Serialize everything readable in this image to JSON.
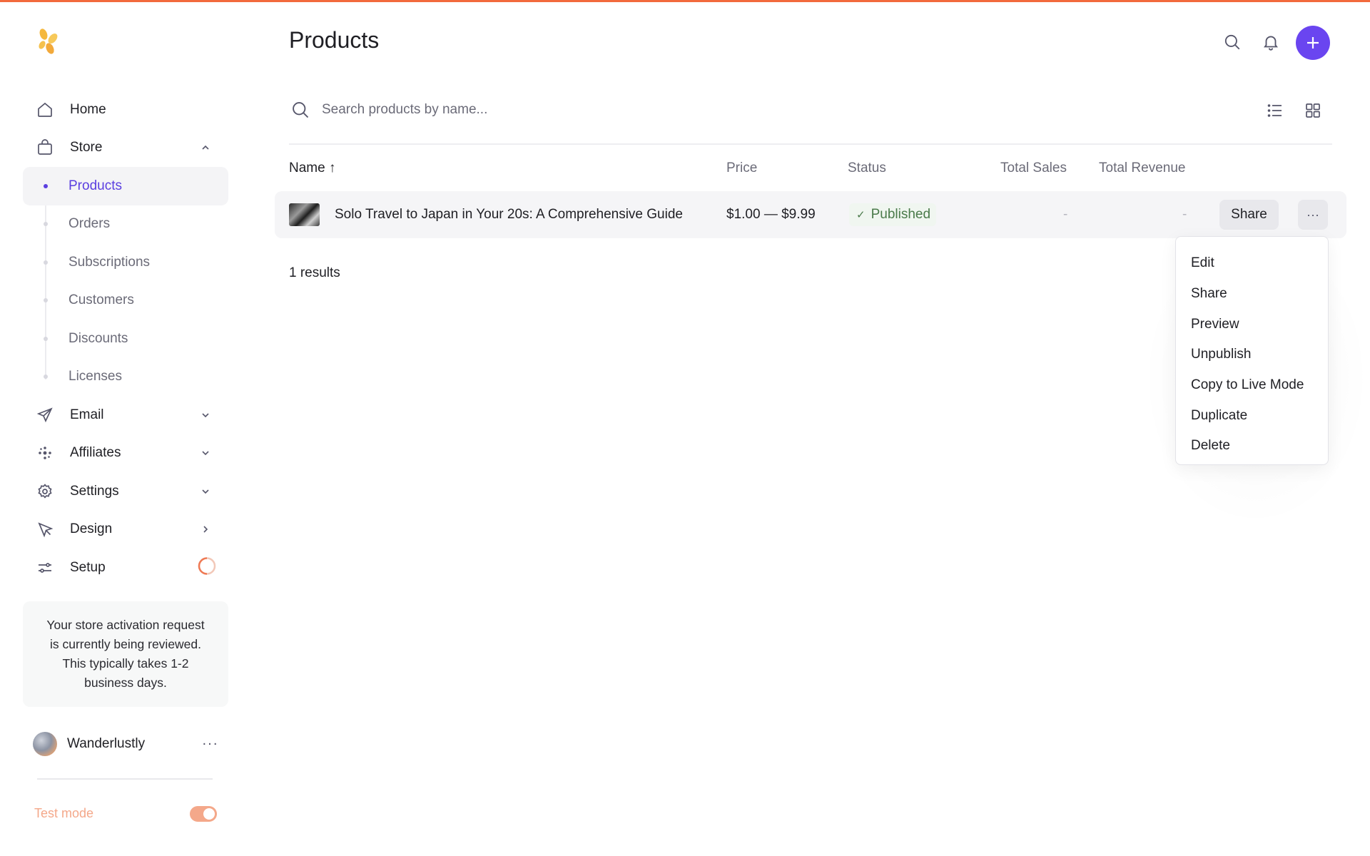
{
  "app": {
    "accent_color": "#6a45f0",
    "top_bar_color": "#f26a3d"
  },
  "sidebar": {
    "logo_icon": "petal-logo-icon",
    "items": [
      {
        "label": "Home",
        "icon": "home-icon"
      },
      {
        "label": "Store",
        "icon": "shopping-bag-icon",
        "expanded": true
      },
      {
        "label": "Email",
        "icon": "paper-plane-icon"
      },
      {
        "label": "Affiliates",
        "icon": "affiliates-icon"
      },
      {
        "label": "Settings",
        "icon": "gear-icon"
      },
      {
        "label": "Design",
        "icon": "cursor-icon"
      },
      {
        "label": "Setup",
        "icon": "sliders-icon"
      }
    ],
    "store_subitems": [
      {
        "label": "Products",
        "active": true
      },
      {
        "label": "Orders"
      },
      {
        "label": "Subscriptions"
      },
      {
        "label": "Customers"
      },
      {
        "label": "Discounts"
      },
      {
        "label": "Licenses"
      }
    ],
    "activation_message": "Your store activation request is currently being reviewed. This typically takes 1-2 business days.",
    "user": {
      "name": "Wanderlustly",
      "more": "···"
    },
    "test_mode": {
      "label": "Test mode",
      "enabled": true
    }
  },
  "header": {
    "title": "Products",
    "icons": [
      "search-icon",
      "bell-icon",
      "plus-icon"
    ]
  },
  "search": {
    "placeholder": "Search products by name..."
  },
  "table": {
    "columns": {
      "name": "Name ↑",
      "price": "Price",
      "status": "Status",
      "total_sales": "Total Sales",
      "total_revenue": "Total Revenue"
    },
    "rows": [
      {
        "name": "Solo Travel to Japan in Your 20s: A Comprehensive Guide",
        "price": "$1.00 — $9.99",
        "status": "Published",
        "total_sales": "-",
        "total_revenue": "-",
        "share_label": "Share",
        "more_label": "···"
      }
    ],
    "results_text": "1 results"
  },
  "dropdown": {
    "items": [
      "Edit",
      "Share",
      "Preview",
      "Unpublish",
      "Copy to Live Mode",
      "Duplicate",
      "Delete"
    ]
  }
}
